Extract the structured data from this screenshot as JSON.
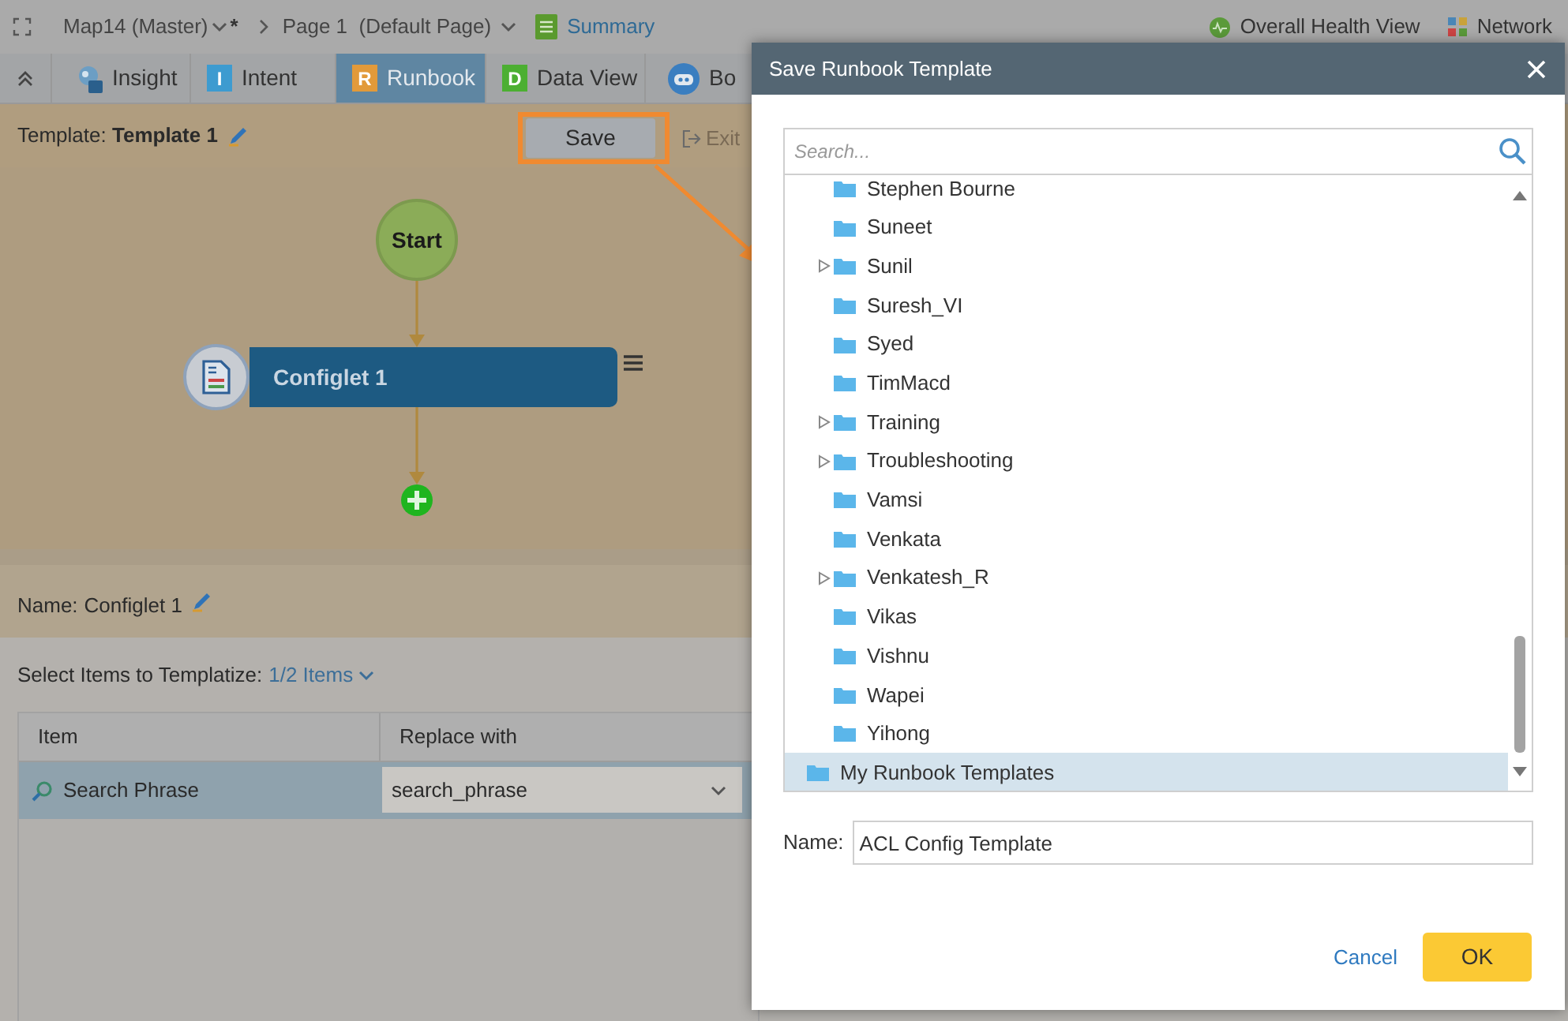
{
  "breadcrumb": {
    "map": "Map14 (Master)",
    "modified_mark": "*",
    "page": "Page 1  (Default Page)",
    "view_link": "Summary"
  },
  "top_links": [
    {
      "label": "Overall Health View",
      "kind": "health"
    },
    {
      "label": "Network",
      "kind": "network"
    }
  ],
  "tabs": [
    {
      "label": "Insight",
      "kind": "ai",
      "selected": false
    },
    {
      "label": "Intent",
      "kind": "letter",
      "badge": "I",
      "color": "#3d9bd0",
      "selected": false
    },
    {
      "label": "Runbook",
      "kind": "letter",
      "badge": "R",
      "color": "#e29a3a",
      "selected": true
    },
    {
      "label": "Data View",
      "kind": "letter",
      "badge": "D",
      "color": "#4caf32",
      "selected": false
    },
    {
      "label": "Bo",
      "kind": "bot",
      "selected": false
    }
  ],
  "template": {
    "label": "Template:",
    "name": "Template 1"
  },
  "toolbar": {
    "save": "Save",
    "exit": "Exit"
  },
  "flow": {
    "start": "Start",
    "nodes": [
      {
        "label": "Configlet 1"
      }
    ]
  },
  "node_name": {
    "label": "Name:",
    "value": "Configlet 1"
  },
  "templatize": {
    "label": "Select Items to Templatize:",
    "count": "1/2 Items"
  },
  "table": {
    "columns": [
      "Item",
      "Replace with"
    ],
    "rows": [
      {
        "item": "Search Phrase",
        "replace_with": "search_phrase",
        "selected": true
      }
    ]
  },
  "dialog": {
    "title": "Save Runbook Template",
    "search": {
      "placeholder": "Search..."
    },
    "folders": [
      {
        "label": "Stephen Bourne",
        "expandable": false,
        "selected": false
      },
      {
        "label": "Suneet",
        "expandable": false,
        "selected": false
      },
      {
        "label": "Sunil",
        "expandable": true,
        "selected": false
      },
      {
        "label": "Suresh_VI",
        "expandable": false,
        "selected": false
      },
      {
        "label": "Syed",
        "expandable": false,
        "selected": false
      },
      {
        "label": "TimMacd",
        "expandable": false,
        "selected": false
      },
      {
        "label": "Training",
        "expandable": true,
        "selected": false
      },
      {
        "label": "Troubleshooting",
        "expandable": true,
        "selected": false
      },
      {
        "label": "Vamsi",
        "expandable": false,
        "selected": false
      },
      {
        "label": "Venkata",
        "expandable": false,
        "selected": false
      },
      {
        "label": "Venkatesh_R",
        "expandable": true,
        "selected": false
      },
      {
        "label": "Vikas",
        "expandable": false,
        "selected": false
      },
      {
        "label": "Vishnu",
        "expandable": false,
        "selected": false
      },
      {
        "label": "Wapei",
        "expandable": false,
        "selected": false
      },
      {
        "label": "Yihong",
        "expandable": false,
        "selected": false
      }
    ],
    "root_folders": [
      {
        "label": "My Runbook Templates",
        "expandable": false,
        "selected": true
      }
    ],
    "name": {
      "label": "Name:",
      "value": "ACL Config Template"
    },
    "buttons": {
      "cancel": "Cancel",
      "ok": "OK"
    }
  }
}
